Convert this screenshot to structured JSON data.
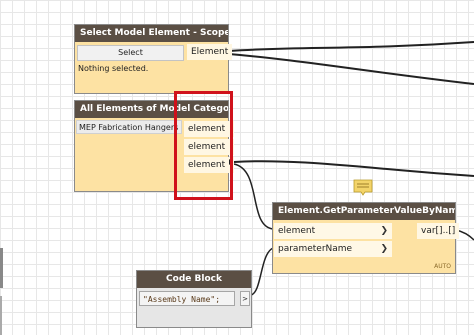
{
  "scope_box_node": {
    "title": "Select Model Element - Scope Box",
    "select_label": "Select",
    "output_label": "Element",
    "status": "Nothing selected."
  },
  "category_node": {
    "title": "All Elements of Model Category",
    "selected_category": "MEP Fabrication Hangers",
    "outputs": [
      "element",
      "element",
      "element"
    ]
  },
  "get_param_node": {
    "title": "Element.GetParameterValueByName",
    "inputs": [
      "element",
      "parameterName"
    ],
    "output_label": "var[]..[]",
    "lacing": "AUTO"
  },
  "code_block_node": {
    "title": "Code Block",
    "code": "\"Assembly Name\";",
    "output_arrow": ">"
  },
  "colors": {
    "node_header": "#5b4f44",
    "node_body": "#fde2a3",
    "highlight": "#d0121b",
    "wire": "#222222"
  },
  "icons": {
    "note": "note-icon",
    "port_arrow": "chevron-right-icon"
  }
}
